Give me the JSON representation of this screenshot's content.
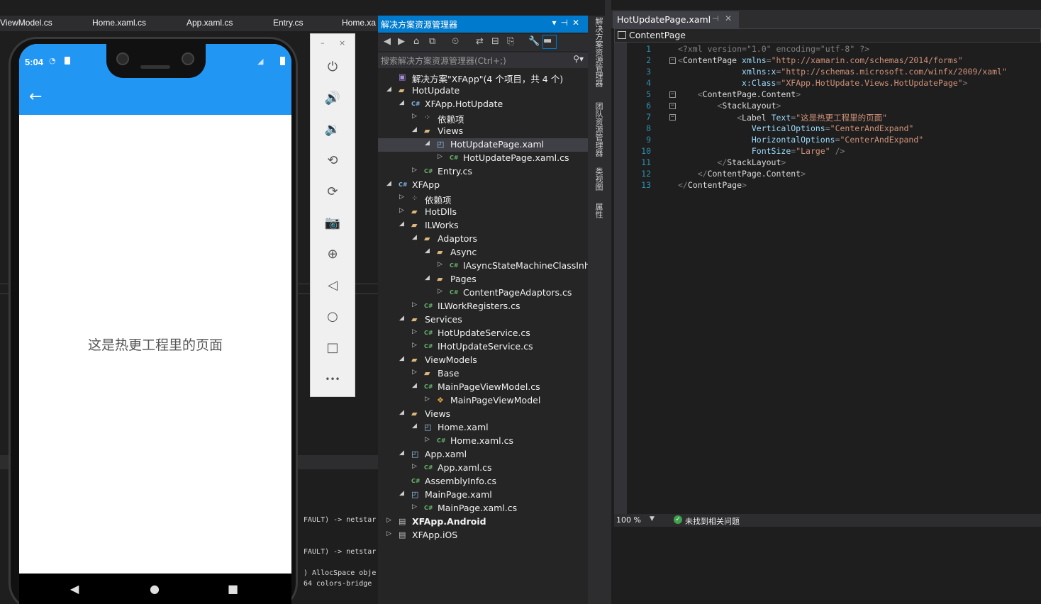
{
  "background": {
    "tabs": [
      "ViewModel.cs",
      "Home.xaml.cs",
      "App.xaml.cs",
      "Entry.cs",
      "Home.xa"
    ],
    "output_lines": [
      "FAULT) -> netstar",
      "FAULT) -> netstar",
      ") AllocSpace obje",
      " 64 colors-bridge"
    ]
  },
  "phone": {
    "time": "5:04",
    "back_glyph": "←",
    "page_text": "这是热更工程里的页面",
    "nav": {
      "back": "◀",
      "home": "●",
      "recents": "■"
    }
  },
  "emulator": {
    "minimize": "–",
    "close": "×",
    "buttons": [
      {
        "name": "power-icon",
        "glyph": "⏻"
      },
      {
        "name": "volume-up-icon",
        "glyph": "🔊"
      },
      {
        "name": "volume-down-icon",
        "glyph": "🔉"
      },
      {
        "name": "rotate-left-icon",
        "glyph": "⟲"
      },
      {
        "name": "rotate-right-icon",
        "glyph": "⟳"
      },
      {
        "name": "camera-icon",
        "glyph": "📷"
      },
      {
        "name": "zoom-icon",
        "glyph": "⊕"
      },
      {
        "name": "back-icon",
        "glyph": "◁"
      },
      {
        "name": "home-icon",
        "glyph": "○"
      },
      {
        "name": "overview-icon",
        "glyph": "□"
      },
      {
        "name": "more-icon",
        "glyph": "•••"
      }
    ]
  },
  "solution_explorer": {
    "title": "解决方案资源管理器",
    "search_placeholder": "搜索解决方案资源管理器(Ctrl+;)",
    "tree": [
      {
        "label": "解决方案\"XFApp\"(4 个项目，共 4 个)",
        "depth": 0,
        "arrow": "",
        "icon": "sln"
      },
      {
        "label": "HotUpdate",
        "depth": 0,
        "arrow": "open",
        "icon": "folder"
      },
      {
        "label": "XFApp.HotUpdate",
        "depth": 1,
        "arrow": "open",
        "icon": "cs-proj"
      },
      {
        "label": "依赖项",
        "depth": 2,
        "arrow": "closed",
        "icon": "deps"
      },
      {
        "label": "Views",
        "depth": 2,
        "arrow": "open",
        "icon": "folder"
      },
      {
        "label": "HotUpdatePage.xaml",
        "depth": 3,
        "arrow": "open",
        "icon": "xaml",
        "selected": true
      },
      {
        "label": "HotUpdatePage.xaml.cs",
        "depth": 4,
        "arrow": "closed",
        "icon": "cs"
      },
      {
        "label": "Entry.cs",
        "depth": 2,
        "arrow": "closed",
        "icon": "cs"
      },
      {
        "label": "XFApp",
        "depth": 0,
        "arrow": "open",
        "icon": "cs-proj"
      },
      {
        "label": "依赖项",
        "depth": 1,
        "arrow": "closed",
        "icon": "deps"
      },
      {
        "label": "HotDlls",
        "depth": 1,
        "arrow": "closed",
        "icon": "folder"
      },
      {
        "label": "ILWorks",
        "depth": 1,
        "arrow": "open",
        "icon": "folder"
      },
      {
        "label": "Adaptors",
        "depth": 2,
        "arrow": "open",
        "icon": "folder"
      },
      {
        "label": "Async",
        "depth": 3,
        "arrow": "open",
        "icon": "folder"
      },
      {
        "label": "IAsyncStateMachineClassInher",
        "depth": 4,
        "arrow": "closed",
        "icon": "cs"
      },
      {
        "label": "Pages",
        "depth": 3,
        "arrow": "open",
        "icon": "folder"
      },
      {
        "label": "ContentPageAdaptors.cs",
        "depth": 4,
        "arrow": "closed",
        "icon": "cs"
      },
      {
        "label": "ILWorkRegisters.cs",
        "depth": 2,
        "arrow": "closed",
        "icon": "cs"
      },
      {
        "label": "Services",
        "depth": 1,
        "arrow": "open",
        "icon": "folder"
      },
      {
        "label": "HotUpdateService.cs",
        "depth": 2,
        "arrow": "closed",
        "icon": "cs"
      },
      {
        "label": "IHotUpdateService.cs",
        "depth": 2,
        "arrow": "closed",
        "icon": "cs"
      },
      {
        "label": "ViewModels",
        "depth": 1,
        "arrow": "open",
        "icon": "folder"
      },
      {
        "label": "Base",
        "depth": 2,
        "arrow": "closed",
        "icon": "folder"
      },
      {
        "label": "MainPageViewModel.cs",
        "depth": 2,
        "arrow": "open",
        "icon": "cs"
      },
      {
        "label": "MainPageViewModel",
        "depth": 3,
        "arrow": "closed",
        "icon": "class"
      },
      {
        "label": "Views",
        "depth": 1,
        "arrow": "open",
        "icon": "folder"
      },
      {
        "label": "Home.xaml",
        "depth": 2,
        "arrow": "open",
        "icon": "xaml"
      },
      {
        "label": "Home.xaml.cs",
        "depth": 3,
        "arrow": "closed",
        "icon": "cs"
      },
      {
        "label": "App.xaml",
        "depth": 1,
        "arrow": "open",
        "icon": "xaml"
      },
      {
        "label": "App.xaml.cs",
        "depth": 2,
        "arrow": "closed",
        "icon": "cs"
      },
      {
        "label": "AssemblyInfo.cs",
        "depth": 1,
        "arrow": "",
        "icon": "cs"
      },
      {
        "label": "MainPage.xaml",
        "depth": 1,
        "arrow": "open",
        "icon": "xaml"
      },
      {
        "label": "MainPage.xaml.cs",
        "depth": 2,
        "arrow": "closed",
        "icon": "cs"
      },
      {
        "label": "XFApp.Android",
        "depth": 0,
        "arrow": "closed",
        "icon": "proj",
        "bold": true
      },
      {
        "label": "XFApp.iOS",
        "depth": 0,
        "arrow": "closed",
        "icon": "proj"
      }
    ]
  },
  "side_tabs": [
    "解决方案资源管理器",
    "团队资源管理器",
    "类视图",
    "属性"
  ],
  "editor": {
    "tab": "HotUpdatePage.xaml",
    "nav_combo": "ContentPage",
    "zoom": "100 %",
    "issues": "未找到相关问题",
    "lines": [
      {
        "n": "1",
        "fold": "",
        "indent": "",
        "tokens": [
          [
            "t-br",
            "<?"
          ],
          [
            "t-br",
            "xml version=\"1.0\" encoding=\"utf-8\" "
          ],
          [
            "t-br",
            "?>"
          ]
        ]
      },
      {
        "n": "2",
        "fold": "⊟",
        "indent": "",
        "tokens": [
          [
            "t-br",
            "<"
          ],
          [
            "t-el",
            "ContentPage "
          ],
          [
            "t-at",
            "xmlns"
          ],
          [
            "t-br",
            "="
          ],
          [
            "t-q",
            "\"http://xamarin.com/schemas/2014/forms\""
          ]
        ]
      },
      {
        "n": "3",
        "fold": "",
        "indent": "             ",
        "tokens": [
          [
            "t-at",
            "xmlns:x"
          ],
          [
            "t-br",
            "="
          ],
          [
            "t-q",
            "\"http://schemas.microsoft.com/winfx/2009/xaml\""
          ]
        ]
      },
      {
        "n": "4",
        "fold": "",
        "indent": "             ",
        "tokens": [
          [
            "t-at",
            "x:Class"
          ],
          [
            "t-br",
            "="
          ],
          [
            "t-q",
            "\"XFApp.HotUpdate.Views.HotUpdatePage\""
          ],
          [
            "t-br",
            ">"
          ]
        ]
      },
      {
        "n": "5",
        "fold": "⊟",
        "indent": "    ",
        "tokens": [
          [
            "t-br",
            "<"
          ],
          [
            "t-el",
            "ContentPage.Content"
          ],
          [
            "t-br",
            ">"
          ]
        ]
      },
      {
        "n": "6",
        "fold": "⊟",
        "indent": "        ",
        "tokens": [
          [
            "t-br",
            "<"
          ],
          [
            "t-el",
            "StackLayout"
          ],
          [
            "t-br",
            ">"
          ]
        ]
      },
      {
        "n": "7",
        "fold": "⊟",
        "indent": "            ",
        "tokens": [
          [
            "t-br",
            "<"
          ],
          [
            "t-el",
            "Label "
          ],
          [
            "t-at",
            "Text"
          ],
          [
            "t-br",
            "="
          ],
          [
            "t-q",
            "\"这是热更工程里的页面\""
          ]
        ]
      },
      {
        "n": "8",
        "fold": "",
        "indent": "               ",
        "tokens": [
          [
            "t-at",
            "VerticalOptions"
          ],
          [
            "t-br",
            "="
          ],
          [
            "t-q",
            "\"CenterAndExpand\""
          ]
        ]
      },
      {
        "n": "9",
        "fold": "",
        "indent": "               ",
        "tokens": [
          [
            "t-at",
            "HorizontalOptions"
          ],
          [
            "t-br",
            "="
          ],
          [
            "t-q",
            "\"CenterAndExpand\""
          ]
        ]
      },
      {
        "n": "10",
        "fold": "",
        "indent": "               ",
        "tokens": [
          [
            "t-at",
            "FontSize"
          ],
          [
            "t-br",
            "="
          ],
          [
            "t-q",
            "\"Large\""
          ],
          [
            "t-br",
            " />"
          ]
        ]
      },
      {
        "n": "11",
        "fold": "",
        "indent": "        ",
        "tokens": [
          [
            "t-br",
            "</"
          ],
          [
            "t-el",
            "StackLayout"
          ],
          [
            "t-br",
            ">"
          ]
        ]
      },
      {
        "n": "12",
        "fold": "",
        "indent": "    ",
        "tokens": [
          [
            "t-br",
            "</"
          ],
          [
            "t-el",
            "ContentPage.Content"
          ],
          [
            "t-br",
            ">"
          ]
        ]
      },
      {
        "n": "13",
        "fold": "",
        "indent": "",
        "tokens": [
          [
            "t-br",
            "</"
          ],
          [
            "t-el",
            "ContentPage"
          ],
          [
            "t-br",
            ">"
          ]
        ]
      }
    ]
  },
  "colors": {
    "accent": "#007acc",
    "phone_bar": "#2196f3",
    "string": "#ce9178",
    "attr": "#9cdcfe",
    "line_number": "#2b91af"
  }
}
